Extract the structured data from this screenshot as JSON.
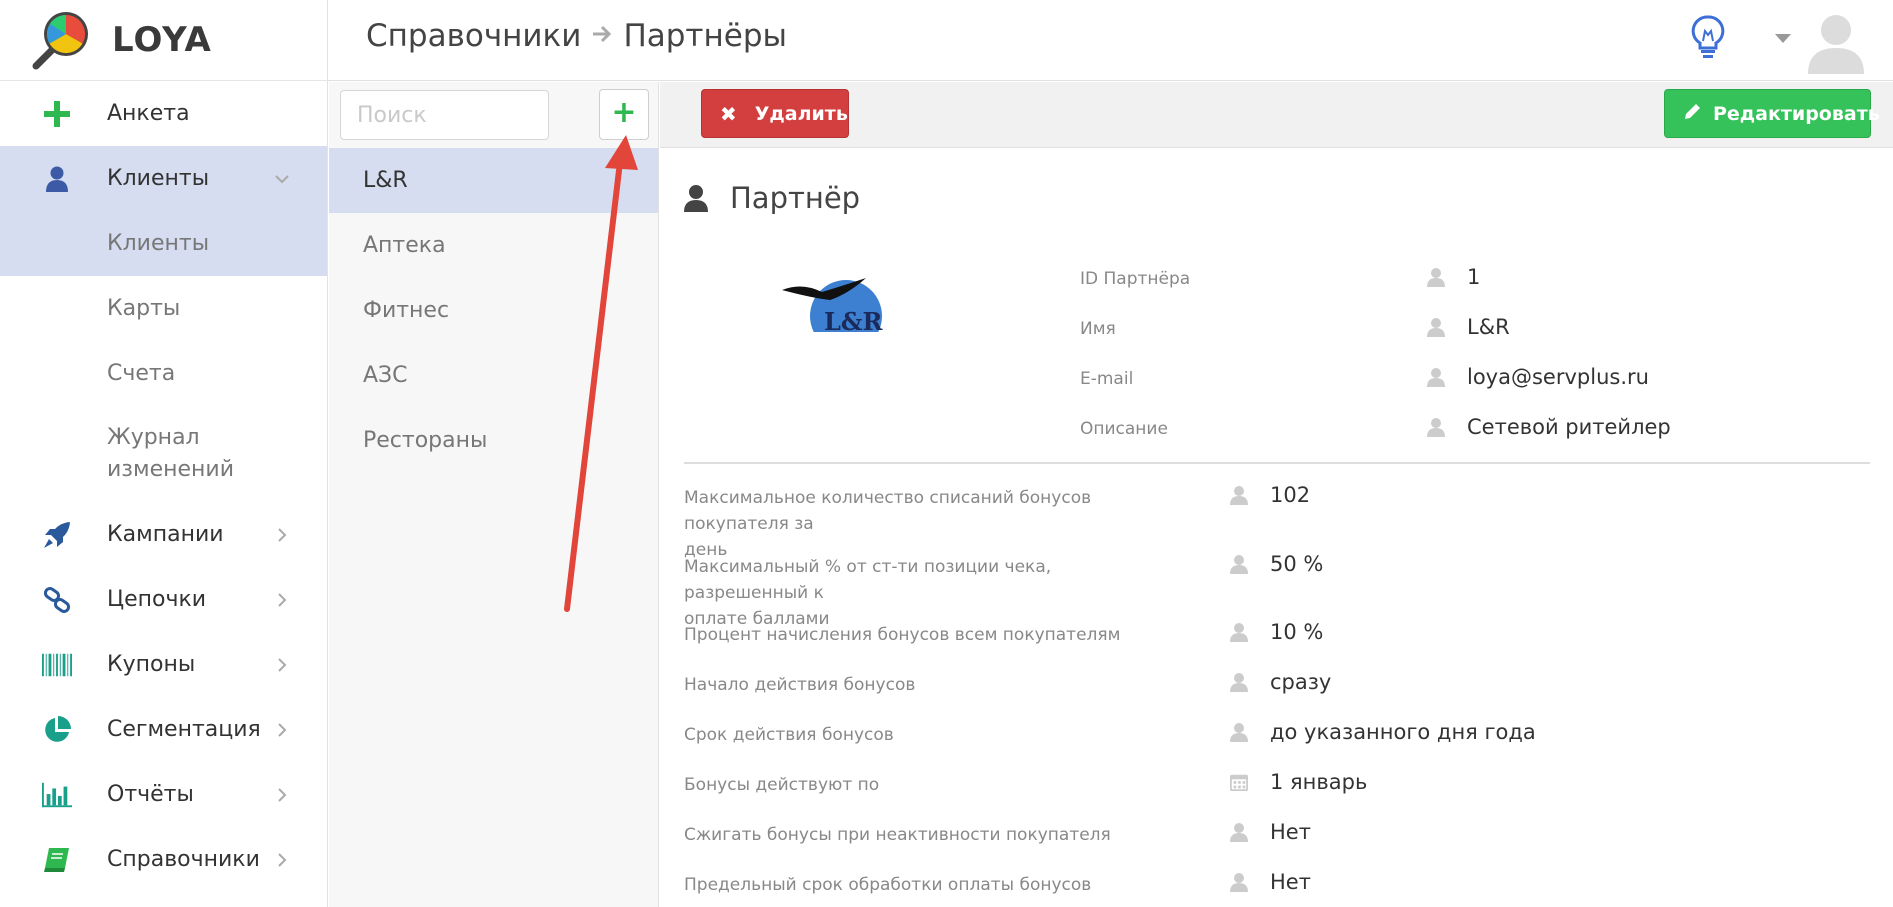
{
  "app": {
    "name": "LOYA"
  },
  "header": {
    "breadcrumb": [
      "Справочники",
      "Партнёры"
    ]
  },
  "sidebar": {
    "items": [
      {
        "label": "Анкета",
        "icon": "plus-icon"
      },
      {
        "label": "Клиенты",
        "icon": "user-icon",
        "expanded": true,
        "children": [
          "Клиенты",
          "Карты",
          "Счета",
          "Журнал изменений"
        ]
      },
      {
        "label": "Кампании",
        "icon": "rocket-icon"
      },
      {
        "label": "Цепочки",
        "icon": "chain-icon"
      },
      {
        "label": "Купоны",
        "icon": "barcode-icon"
      },
      {
        "label": "Сегментация",
        "icon": "pie-icon"
      },
      {
        "label": "Отчёты",
        "icon": "bar-chart-icon"
      },
      {
        "label": "Справочники",
        "icon": "book-icon"
      }
    ],
    "sub_journal_line1": "Журнал",
    "sub_journal_line2": "изменений"
  },
  "list": {
    "search_placeholder": "Поиск",
    "add_label": "+",
    "partners": [
      "L&R",
      "Аптека",
      "Фитнес",
      "АЗС",
      "Рестораны"
    ]
  },
  "toolbar": {
    "delete_label": "Удалить",
    "edit_label": "Редактировать"
  },
  "detail": {
    "title": "Партнёр",
    "logo_text": "L&R",
    "fields": [
      {
        "label": "ID Партнёра",
        "value": "1"
      },
      {
        "label": "Имя",
        "value": "L&R"
      },
      {
        "label": "E-mail",
        "value": "loya@servplus.ru"
      },
      {
        "label": "Описание",
        "value": "Сетевой ритейлер"
      }
    ],
    "settings": [
      {
        "label_1": "Максимальное количество списаний бонусов покупателя за",
        "label_2": "день",
        "value": "102"
      },
      {
        "label_1": "Максимальный % от ст-ти позиции чека, разрешенный к",
        "label_2": "оплате баллами",
        "value": "50 %"
      },
      {
        "label_1": "Процент начисления бонусов всем покупателям",
        "value": "10 %"
      },
      {
        "label_1": "Начало действия бонусов",
        "value": "сразу"
      },
      {
        "label_1": "Срок действия бонусов",
        "value": "до указанного дня года"
      },
      {
        "label_1": "Бонусы действуют по",
        "value": "1 январь"
      },
      {
        "label_1": "Сжигать бонусы при неактивности покупателя",
        "value": "Нет"
      },
      {
        "label_1": "Предельный срок обработки оплаты бонусов",
        "value": "Нет"
      }
    ]
  },
  "colors": {
    "accent_active": "#d6ddf1",
    "delete": "#d33f3f",
    "edit": "#35c25a",
    "annotation_arrow": "#e2453a"
  }
}
